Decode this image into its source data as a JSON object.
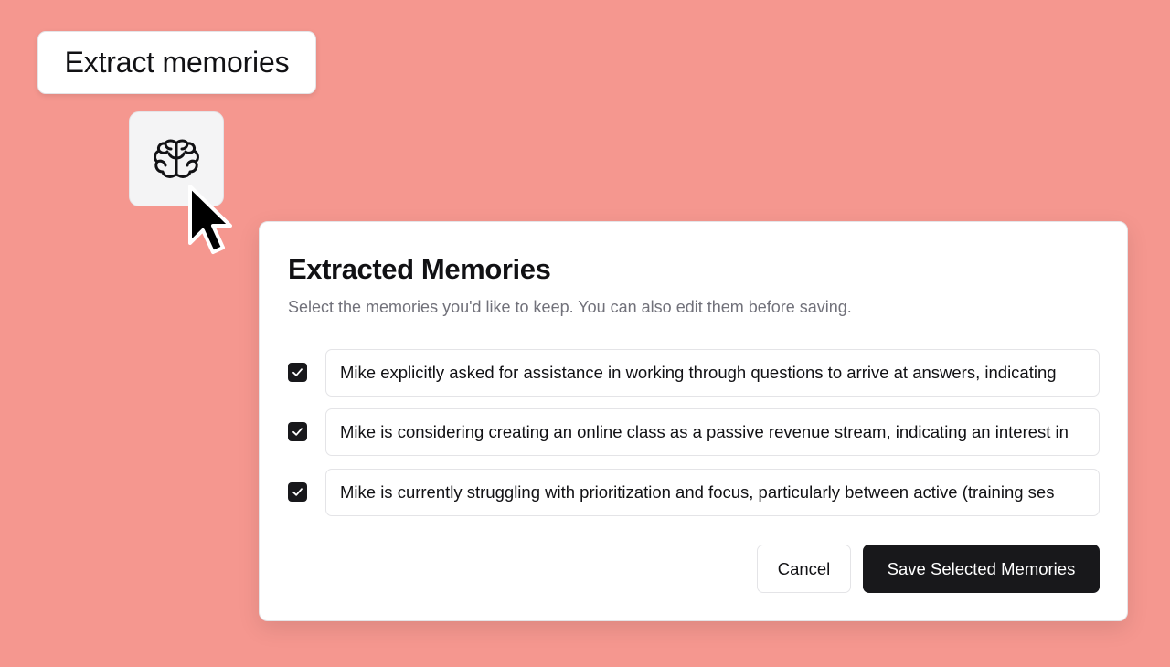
{
  "tooltip": {
    "label": "Extract memories"
  },
  "toolbar": {
    "extract_button_icon": "brain-icon"
  },
  "dialog": {
    "title": "Extracted Memories",
    "description": "Select the memories you'd like to keep. You can also edit them before saving.",
    "memories": [
      {
        "checked": true,
        "text": "Mike explicitly asked for assistance in working through questions to arrive at answers, indicating"
      },
      {
        "checked": true,
        "text": "Mike is considering creating an online class as a passive revenue stream, indicating an interest in"
      },
      {
        "checked": true,
        "text": "Mike is currently struggling with prioritization and focus, particularly between active (training ses"
      }
    ],
    "cancel_label": "Cancel",
    "save_label": "Save Selected Memories"
  },
  "colors": {
    "background": "#f5978f",
    "primary_button": "#18181b",
    "muted_text": "#71717a",
    "border": "#e4e4e7"
  }
}
